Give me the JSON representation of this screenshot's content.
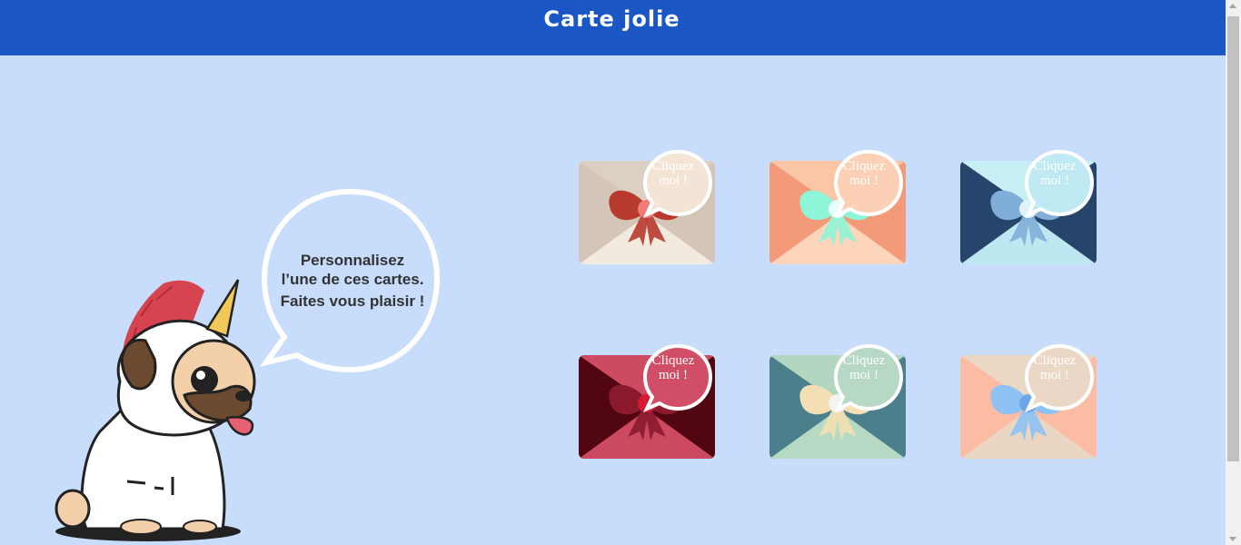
{
  "header": {
    "title": "Carte jolie",
    "background": "#1a57c4"
  },
  "intro": {
    "line1": "Personnalisez",
    "line2": "l’une de ces cartes.",
    "line3": "Faites vous plaisir !"
  },
  "cards": [
    {
      "label_line1": "Cliquez",
      "label_line2": "moi !",
      "colors": {
        "top": "#dccfc4",
        "side": "#d4c5b8",
        "bottom": "#f2e9df",
        "bow": "#b83a2e",
        "knot": "#f07c78",
        "bubble": "#f4e4d6"
      }
    },
    {
      "label_line1": "Cliquez",
      "label_line2": "moi !",
      "colors": {
        "top": "#fbc6a6",
        "side": "#f39a78",
        "bottom": "#fdd5bb",
        "bow": "#8ff5d8",
        "knot": "#e8fffb",
        "bubble": "#fbd0b4"
      }
    },
    {
      "label_line1": "Cliquez",
      "label_line2": "moi !",
      "colors": {
        "top": "#c7eef4",
        "side": "#27456a",
        "bottom": "#bde7f1",
        "bow": "#80aed8",
        "knot": "#dff4fa",
        "bubble": "#bfe9f3"
      }
    },
    {
      "label_line1": "Cliquez",
      "label_line2": "moi !",
      "colors": {
        "top": "#cd4b61",
        "side": "#520612",
        "bottom": "#cb4a60",
        "bow": "#8b1b2c",
        "knot": "#d61a35",
        "bubble": "#d14f66"
      }
    },
    {
      "label_line1": "Cliquez",
      "label_line2": "moi !",
      "colors": {
        "top": "#b3d6c1",
        "side": "#4b7f8c",
        "bottom": "#b6d9c4",
        "bow": "#f3dfb3",
        "knot": "#f3f5ef",
        "bubble": "#b6d8c5"
      }
    },
    {
      "label_line1": "Cliquez",
      "label_line2": "moi !",
      "colors": {
        "top": "#ead7c4",
        "side": "#fcbca3",
        "bottom": "#ead6c2",
        "bow": "#8ec2f4",
        "knot": "#6fa6e8",
        "bubble": "#ead7c6"
      }
    }
  ]
}
